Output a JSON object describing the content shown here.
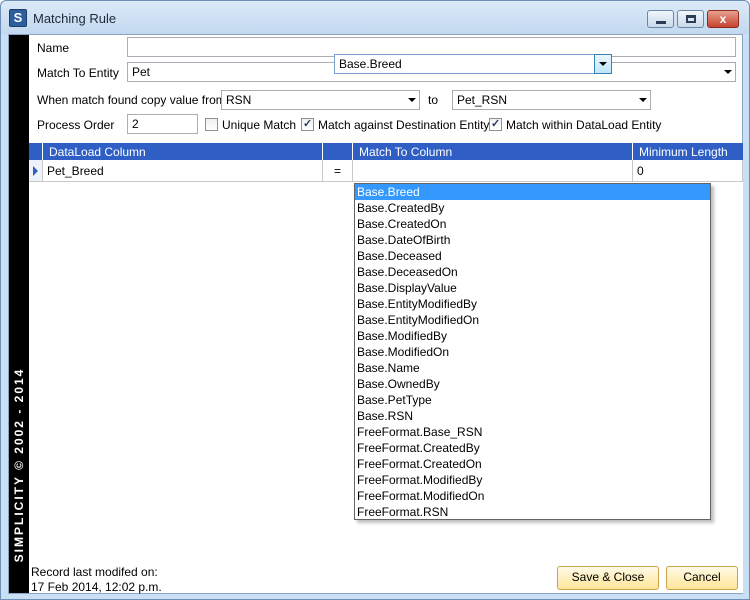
{
  "window": {
    "title": "Matching Rule",
    "app_icon_letter": "S",
    "close_glyph": "x"
  },
  "brand": {
    "text": "SIMPLICITY © 2002 - 2014"
  },
  "form": {
    "name_label": "Name",
    "name_value": "",
    "entity_label": "Match To Entity",
    "entity_value": "Pet",
    "copy_label": "When match found copy value from",
    "copy_from_value": "RSN",
    "to_label": "to",
    "copy_to_value": "Pet_RSN",
    "process_order_label": "Process Order",
    "process_order_value": "2",
    "unique_match_label": "Unique Match",
    "unique_match_checked": false,
    "match_dest_label": "Match against Destination Entity",
    "match_dest_checked": true,
    "match_within_label": "Match within DataLoad Entity",
    "match_within_checked": true
  },
  "grid": {
    "headers": {
      "dataload_column": "DataLoad Column",
      "operator": "",
      "match_to_column": "Match To Column",
      "minimum_length": "Minimum Length"
    },
    "rows": [
      {
        "dataload_column": "Pet_Breed",
        "operator": "=",
        "match_to_column": "Base.Breed",
        "minimum_length": "0"
      }
    ]
  },
  "dropdown": {
    "selected": "Base.Breed",
    "options": [
      "Base.Breed",
      "Base.CreatedBy",
      "Base.CreatedOn",
      "Base.DateOfBirth",
      "Base.Deceased",
      "Base.DeceasedOn",
      "Base.DisplayValue",
      "Base.EntityModifiedBy",
      "Base.EntityModifiedOn",
      "Base.ModifiedBy",
      "Base.ModifiedOn",
      "Base.Name",
      "Base.OwnedBy",
      "Base.PetType",
      "Base.RSN",
      "FreeFormat.Base_RSN",
      "FreeFormat.CreatedBy",
      "FreeFormat.CreatedOn",
      "FreeFormat.ModifiedBy",
      "FreeFormat.ModifiedOn",
      "FreeFormat.RSN"
    ]
  },
  "footer": {
    "modified_label": "Record last modifed on:",
    "modified_value": "17 Feb 2014, 12:02 p.m.",
    "save_label": "Save & Close",
    "cancel_label": "Cancel"
  }
}
